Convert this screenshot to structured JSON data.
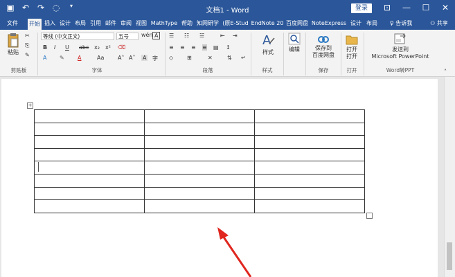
{
  "titlebar": {
    "title": "文档1 - Word",
    "login": "登录",
    "qat_icons": [
      "save-icon",
      "undo-icon",
      "redo-icon",
      "touch-mode-icon"
    ],
    "window_controls": [
      "ribbon-display-icon",
      "minimize-icon",
      "maximize-icon",
      "close-icon"
    ]
  },
  "tabs": [
    "文件",
    "开始",
    "插入",
    "设计",
    "布局",
    "引用",
    "邮件",
    "审阅",
    "视图",
    "MathType",
    "帮助",
    "知网研学",
    "(原E-Stud",
    "EndNote 20",
    "百度网盘",
    "NoteExpress",
    "设计",
    "布局"
  ],
  "active_tab": "开始",
  "tell_me": "告诉我",
  "share": "共享",
  "ribbon": {
    "clipboard": {
      "paste": "粘贴",
      "group": "剪贴板"
    },
    "font": {
      "font_name": "等线 (中文正文)",
      "font_size": "五号",
      "wen": "wén",
      "A_box": "A",
      "bold": "B",
      "italic": "I",
      "underline": "U",
      "strike": "abc",
      "sub": "x₂",
      "sup": "x²",
      "font_color": "A",
      "change_case": "Aa",
      "grow": "A˄",
      "shrink": "A˅",
      "char_border": "A",
      "enclose": "字",
      "group": "字体"
    },
    "paragraph": {
      "group": "段落"
    },
    "styles": {
      "label": "样式",
      "group": "样式"
    },
    "editing": {
      "label": "编辑"
    },
    "save": {
      "label1": "保存到",
      "label2": "百度网盘",
      "group": "保存"
    },
    "open": {
      "label": "打开",
      "label2": "打开",
      "group": "打开"
    },
    "ppt": {
      "label1": "发送到",
      "label2": "Microsoft PowerPoint",
      "group": "Word转PPT"
    }
  },
  "document": {
    "table": {
      "rows": 8,
      "cols": 3
    },
    "table_move_handle": "+"
  },
  "colors": {
    "accent": "#2b579a",
    "arrow": "#e0261f"
  }
}
